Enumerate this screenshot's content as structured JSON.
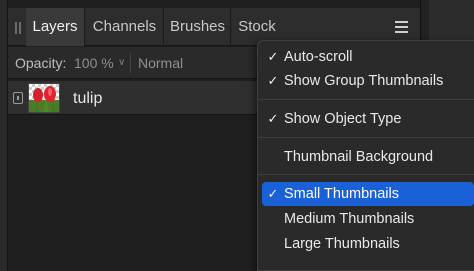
{
  "tabs": [
    {
      "label": "Layers",
      "active": true
    },
    {
      "label": "Channels",
      "active": false
    },
    {
      "label": "Brushes",
      "active": false
    },
    {
      "label": "Stock",
      "active": false
    }
  ],
  "options_bar": {
    "opacity_label": "Opacity:",
    "opacity_value": "100 %",
    "blend_mode": "Normal"
  },
  "layer": {
    "name": "tulip",
    "thumbnail_icon": "tulip-image-thumbnail"
  },
  "panel_menu": {
    "items": [
      {
        "label": "Auto-scroll",
        "checked": true,
        "selected": false
      },
      {
        "label": "Show Group Thumbnails",
        "checked": true,
        "selected": false
      },
      {
        "label": "Show Object Type",
        "checked": true,
        "selected": false
      },
      {
        "label": "Thumbnail Background",
        "checked": false,
        "selected": false
      },
      {
        "label": "Small Thumbnails",
        "checked": true,
        "selected": true
      },
      {
        "label": "Medium Thumbnails",
        "checked": false,
        "selected": false
      },
      {
        "label": "Large Thumbnails",
        "checked": false,
        "selected": false
      }
    ],
    "check_glyph": "✓"
  },
  "colors": {
    "selection": "#1a60d6",
    "panel_bg": "#1f1f1f",
    "menu_bg": "#2a2a2a"
  }
}
